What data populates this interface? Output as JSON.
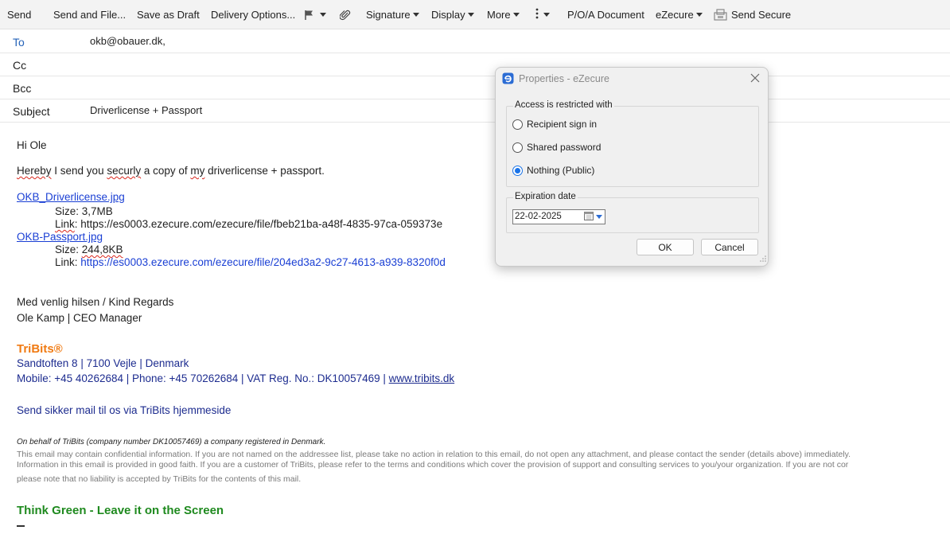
{
  "toolbar": {
    "send": "Send",
    "send_and_file": "Send and File...",
    "save_as_draft": "Save as Draft",
    "delivery_options": "Delivery Options...",
    "signature": "Signature",
    "display": "Display",
    "more": "More",
    "poa_document": "P/O/A Document",
    "ezecure": "eZecure",
    "send_secure": "Send Secure"
  },
  "header": {
    "to_label": "To",
    "to_value": "okb@obauer.dk,",
    "cc_label": "Cc",
    "cc_value": "",
    "bcc_label": "Bcc",
    "bcc_value": "",
    "subject_label": "Subject",
    "subject_value": "Driverlicense + Passport"
  },
  "message": {
    "greeting": "Hi Ole",
    "intro_1": "Hereby",
    "intro_2": " I send you ",
    "intro_3": "securly",
    "intro_4": " a copy of ",
    "intro_5": "my",
    "intro_6": " driverlicense + passport.",
    "file1_name": "OKB_Driverlicense.jpg",
    "file1_size": "Size: 3,7MB",
    "file1_link_label": "Link",
    "file1_link": ": https://es0003.ezecure.com/ezecure/file/fbeb21ba-a48f-4835-97ca-059373e",
    "file2_name": "OKB-Passport.jpg",
    "file2_size_label": "Size: ",
    "file2_size_value": "244,8KB",
    "file2_link_label": "Link: ",
    "file2_link": "https://es0003.ezecure.com/ezecure/file/204ed3a2-9c27-4613-a939-8320f0d",
    "regards": "Med venlig hilsen / Kind Regards",
    "sender": "Ole Kamp | CEO Manager"
  },
  "signature": {
    "company": "TriBits®",
    "address": "Sandtoften 8  |  7100 Vejle  |  Denmark",
    "contact": "Mobile:  +45 40262684  |  Phone:  +45 70262684  |  VAT Reg. No.: DK10057469  |  ",
    "website": "www.tribits.dk",
    "send_secure_text": "Send sikker mail til os via TriBits hjemmeside",
    "behalf": "On behalf of TriBits (company number DK10057469) a company registered in Denmark.",
    "disclaimer_1": "This email may contain confidential information. If you are not named on the addressee list, please take no action in relation to this email, do not open any attachment, and please contact the sender (details above) immediately.",
    "disclaimer_2": "Information in this email is provided in good faith. If you are a customer of TriBits, please refer to the terms and conditions which cover the provision of support and consulting services to you/your organization. If you are not cor",
    "disclaimer_3": "please note that no liability is accepted by TriBits for the contents of this mail.",
    "green_slogan": "Think Green - Leave it on the Screen"
  },
  "dialog": {
    "title": "Properties - eZecure",
    "access_group_title": "Access is restricted with",
    "options": [
      {
        "label": "Recipient sign in",
        "selected": false
      },
      {
        "label": "Shared password",
        "selected": false
      },
      {
        "label": "Nothing (Public)",
        "selected": true
      }
    ],
    "expiration_group_title": "Expiration date",
    "expiration_value": "22-02-2025",
    "ok": "OK",
    "cancel": "Cancel"
  },
  "colors": {
    "accent": "#1a73e8",
    "link": "#1a3fd4",
    "brand_orange": "#f07a12",
    "navy": "#1d2c8f",
    "green": "#1f8a1f"
  },
  "icons": [
    "flag-icon",
    "paperclip-icon",
    "kebab-menu-icon",
    "send-secure-icon",
    "ezecure-logo-icon",
    "close-icon",
    "calendar-icon"
  ]
}
